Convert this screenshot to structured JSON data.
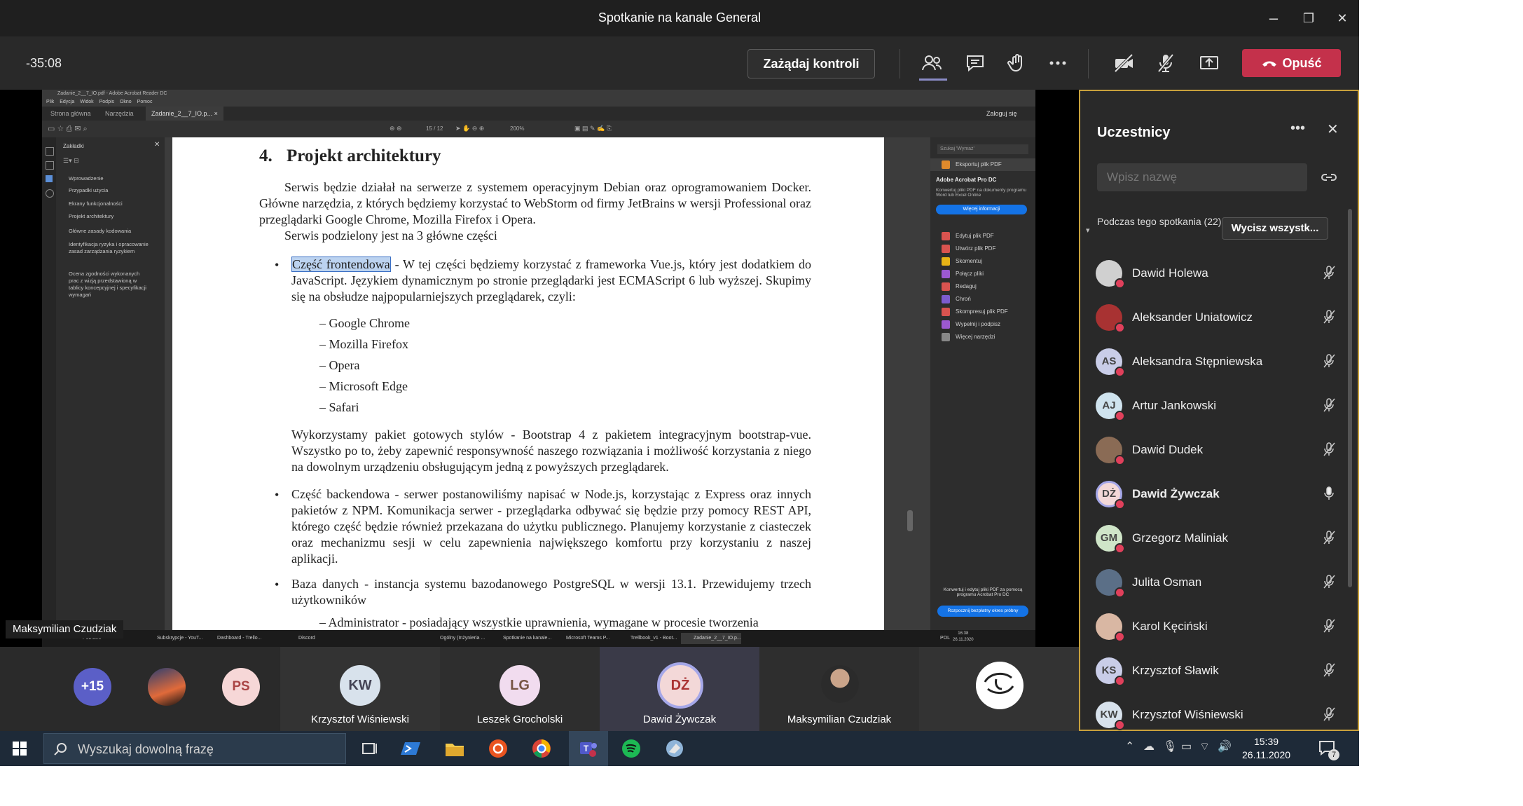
{
  "window": {
    "title": "Spotkanie na kanale General",
    "controls": [
      "–",
      "❐",
      "✕"
    ]
  },
  "toolbar": {
    "timer": "-35:08",
    "request_control": "Zażądaj kontroli",
    "leave": "Opuść",
    "icons": [
      "people-icon",
      "chat-icon",
      "raise-hand-icon",
      "more-icon",
      "camera-off-icon",
      "mic-off-icon",
      "share-icon"
    ]
  },
  "shared_screen": {
    "acrobat_title": "Zadanie_2__7_IO.pdf - Adobe Acrobat Reader DC",
    "menu": [
      "Plik",
      "Edycja",
      "Widok",
      "Podpis",
      "Okno",
      "Pomoc"
    ],
    "tabs": [
      "Strona główna",
      "Narzędzia",
      "Zadanie_2__7_IO.p... ×"
    ],
    "login": "Zaloguj się",
    "page_indicator": "15 / 12",
    "zoom": "200%",
    "bookmarks": {
      "title": "Zakładki",
      "items": [
        "Wprowadzenie",
        "Przypadki użycia",
        "Ekrany funkcjonalności",
        "Projekt architektury",
        "Główne zasady kodowania",
        "Identyfikacja ryzyka i opracowanie zasad zarządzania ryzykiem",
        "Ocena zgodności wykonanych prac z wizją przedstawioną w tablicy koncepcyjnej i specyfikacji wymagań"
      ]
    },
    "document": {
      "section_number": "4.",
      "section_title": "Projekt architektury",
      "intro": "Serwis będzie działał na serwerze z systemem operacyjnym Debian oraz oprogramowaniem Docker. Główne narzędzia, z których będziemy korzystać to WebStorm od firmy JetBrains w wersji Professional oraz przeglądarki Google Chrome, Mozilla Firefox i Opera.",
      "intro2": "Serwis podzielony jest na 3 główne części",
      "bullet1_highlight": "Część frontendowa",
      "bullet1_rest": " - W tej części będziemy korzystać z frameworka Vue.js, który jest dodatkiem do JavaScript. Językiem dynamicznym po stronie przeglądarki jest ECMAScript 6 lub wyższej. Skupimy się na obsłudze najpopularniejszych przeglądarek, czyli:",
      "browsers": [
        "– Google Chrome",
        "– Mozilla Firefox",
        "– Opera",
        "– Microsoft Edge",
        "– Safari"
      ],
      "bootstrap": "Wykorzystamy pakiet gotowych stylów - Bootstrap 4 z pakietem integracyjnym bootstrap-vue. Wszystko po to, żeby zapewnić responsywność naszego rozwiązania i możliwość korzystania z niego na dowolnym urządzeniu obsługującym jedną z powyższych przeglądarek.",
      "bullet2": "Część backendowa - serwer postanowiliśmy napisać w Node.js, korzystając z Express oraz innych pakietów z NPM. Komunikacja serwer - przeglądarka odbywać się będzie przy pomocy REST API, którego część będzie również przekazana do użytku publicznego. Planujemy korzystanie z ciasteczek oraz mechanizmu sesji w celu zapewnienia największego komfortu przy korzystaniu z naszej aplikacji.",
      "bullet3": "Baza danych - instancja systemu bazodanowego PostgreSQL w wersji 13.1. Przewidujemy trzech użytkowników",
      "sub_admin": "– Administrator - posiadający wszystkie uprawnienia, wymagane w procesie tworzenia"
    },
    "right_pane": {
      "search": "Szukaj 'Wymaż'",
      "export": "Eksportuj plik PDF",
      "promo_title": "Adobe Acrobat Pro DC",
      "promo_text": "Konwertuj pliki PDF na dokumenty programu Word lub Excel Online",
      "promo_button": "Więcej informacji",
      "tools": [
        "Edytuj plik PDF",
        "Utwórz plik PDF",
        "Skomentuj",
        "Połącz pliki",
        "Redaguj",
        "Chroń",
        "Skompresuj plik PDF",
        "Wypełnij i podpisz",
        "Więcej narzędzi"
      ],
      "bottom_text": "Konwertuj i edytuj pliki PDF za pomocą programu Acrobat Pro DC",
      "bottom_button": "Rozpocznij bezpłatny okres próbny"
    },
    "inner_taskbar": [
      "Pobrane",
      "Subskrypcje - YouT...",
      "Dashboard - Trello...",
      "Discord",
      "Ogólny (Inżynieria ...",
      "Spotkanie na kanale...",
      "Microsoft Teams P...",
      "Trellbook_v1 - Boot...",
      "Zadanie_2__7_IO.p..."
    ],
    "inner_clock": "16:38",
    "inner_date": "26.11.2020",
    "inner_lang": "POL"
  },
  "presenter_label": "Maksymilian Czudziak",
  "gallery": {
    "more_count": "+15",
    "tiles": [
      {
        "initials": "PS",
        "name": ""
      },
      {
        "initials": "KW",
        "name": "Krzysztof Wiśniewski"
      },
      {
        "initials": "LG",
        "name": "Leszek Grocholski"
      },
      {
        "initials": "DŻ",
        "name": "Dawid Żywczak"
      },
      {
        "initials": "",
        "name": "Maksymilian Czudziak"
      }
    ]
  },
  "participants": {
    "title": "Uczestnicy",
    "search_placeholder": "Wpisz nazwę",
    "section": "Podczas tego spotkania (22)",
    "mute_all": "Wycisz wszystk...",
    "list": [
      {
        "name": "Dawid Holewa",
        "initials": "",
        "color": "#d0d0d0",
        "bold": false,
        "mic": "muted"
      },
      {
        "name": "Aleksander Uniatowicz",
        "initials": "",
        "color": "#a83232",
        "bold": false,
        "mic": "muted"
      },
      {
        "name": "Aleksandra Stępniewska",
        "initials": "AS",
        "color": "#c9cde8",
        "bold": false,
        "mic": "muted"
      },
      {
        "name": "Artur Jankowski",
        "initials": "AJ",
        "color": "#cfe3ee",
        "bold": false,
        "mic": "muted"
      },
      {
        "name": "Dawid Dudek",
        "initials": "",
        "color": "#8a6b55",
        "bold": false,
        "mic": "muted"
      },
      {
        "name": "Dawid Żywczak",
        "initials": "DŻ",
        "color": "#f3d8d8",
        "bold": true,
        "mic": "active"
      },
      {
        "name": "Grzegorz Maliniak",
        "initials": "GM",
        "color": "#cfe5c8",
        "bold": false,
        "mic": "muted"
      },
      {
        "name": "Julita Osman",
        "initials": "",
        "color": "#5b6f87",
        "bold": false,
        "mic": "muted"
      },
      {
        "name": "Karol Kęciński",
        "initials": "",
        "color": "#d9b7a3",
        "bold": false,
        "mic": "muted"
      },
      {
        "name": "Krzysztof Sławik",
        "initials": "KS",
        "color": "#c9cde8",
        "bold": false,
        "mic": "muted"
      },
      {
        "name": "Krzysztof Wiśniewski",
        "initials": "KW",
        "color": "#d8e2ec",
        "bold": false,
        "mic": "muted"
      }
    ]
  },
  "windows_taskbar": {
    "search_placeholder": "Wyszukaj dowolną frazę",
    "clock": "15:39",
    "date": "26.11.2020",
    "notifications": "7"
  }
}
